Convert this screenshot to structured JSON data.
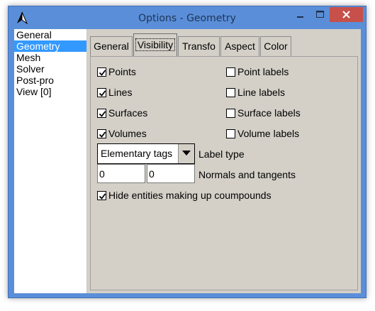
{
  "window": {
    "title": "Options - Geometry",
    "icon": "gmsh-triangle-icon"
  },
  "titlebar_buttons": {
    "minimize": "minimize-icon",
    "maximize": "maximize-icon",
    "close": "close-icon",
    "close_color": "#c7504a"
  },
  "tree": {
    "items": [
      "General",
      "Geometry",
      "Mesh",
      "Solver",
      "Post-pro",
      "View [0]"
    ],
    "selected": "Geometry"
  },
  "tabs": [
    "General",
    "Visibility",
    "Transfo",
    "Aspect",
    "Color"
  ],
  "active_tab": "Visibility",
  "visibility": {
    "entities": [
      {
        "label": "Points",
        "checked": true
      },
      {
        "label": "Lines",
        "checked": true
      },
      {
        "label": "Surfaces",
        "checked": true
      },
      {
        "label": "Volumes",
        "checked": true
      }
    ],
    "labels": [
      {
        "label": "Point labels",
        "checked": false
      },
      {
        "label": "Line labels",
        "checked": false
      },
      {
        "label": "Surface labels",
        "checked": false
      },
      {
        "label": "Volume labels",
        "checked": false
      }
    ],
    "label_type": {
      "value": "Elementary tags",
      "caption": "Label type"
    },
    "normals": {
      "value": "0",
      "tangents": "0",
      "caption": "Normals and tangents"
    },
    "hide_compounds": {
      "label": "Hide entities making up coumpounds",
      "checked": true
    }
  },
  "colors": {
    "accent": "#3399ff",
    "frame": "#5a8ed8",
    "dialog": "#d4d0c8"
  }
}
